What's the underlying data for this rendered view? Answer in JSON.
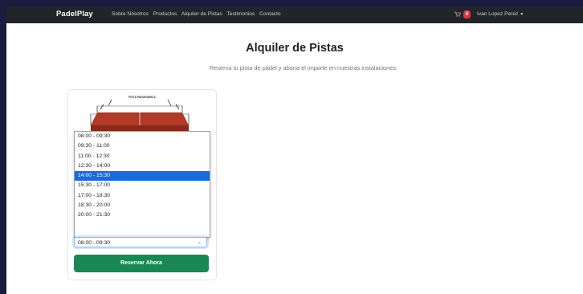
{
  "navbar": {
    "brand": "PadelPlay",
    "links": [
      "Sobre Nosotros",
      "Productos",
      "Alquiler de Pistas",
      "Testimonios",
      "Contacto"
    ],
    "cart_count": "0",
    "user_name": "Ivan Lopez Perez"
  },
  "main": {
    "title": "Alquiler de Pistas",
    "subtitle": "Reserva tu pista de pádel y abona el importe en nuestras instalaciones."
  },
  "card": {
    "image_caption": "PISTA PANORÁMICA",
    "time_options": [
      "08:00 - 09:30",
      "09:30 - 11:00",
      "11:00 - 12:30",
      "12:30 - 14:00",
      "14:00 - 15:30",
      "15:30 - 17:00",
      "17:00 - 18:30",
      "18:30 - 20:00",
      "20:00 - 21:30"
    ],
    "highlighted_option": "14:00 - 15:30",
    "selected_time": "08:00 - 09:30",
    "reserve_label": "Reservar Ahora"
  }
}
